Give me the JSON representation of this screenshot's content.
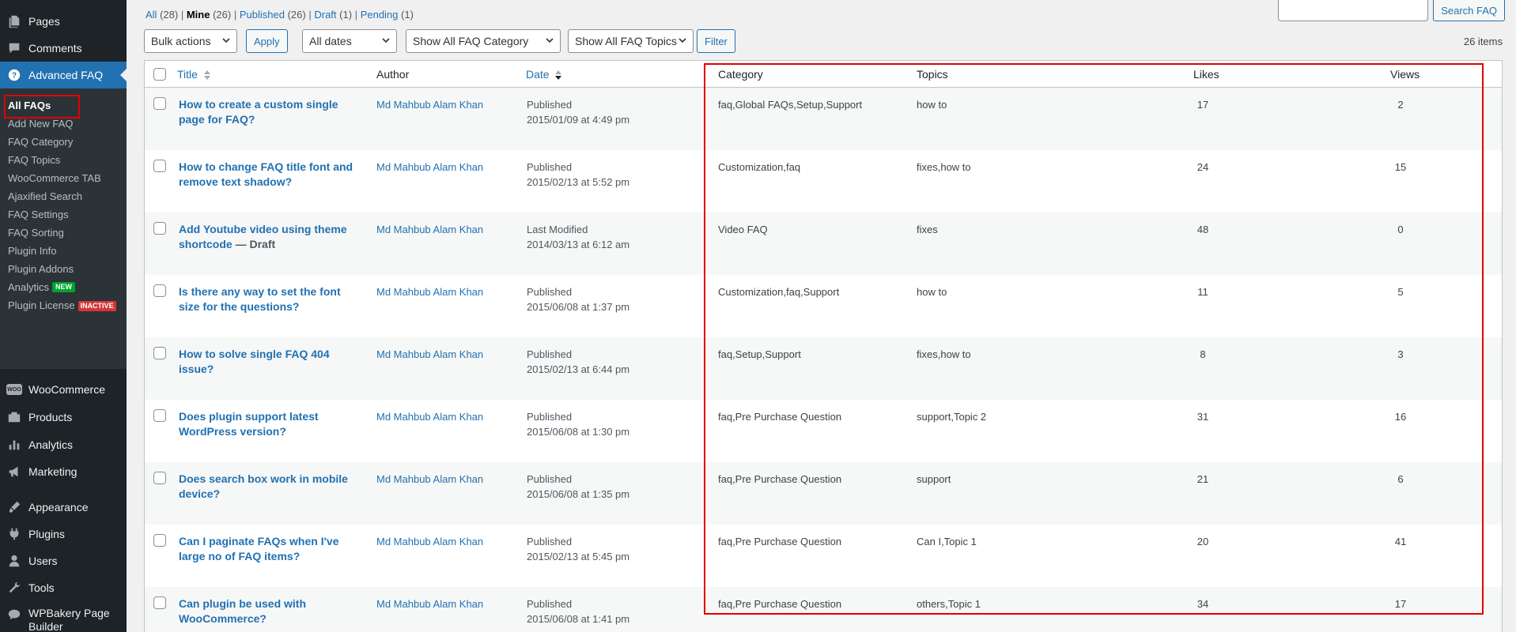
{
  "sidebar": {
    "menu": [
      {
        "label": "Pages",
        "icon": "pages-icon"
      },
      {
        "label": "Comments",
        "icon": "comments-icon"
      },
      {
        "label": "Advanced FAQ",
        "icon": "help-icon"
      }
    ],
    "submenu": [
      {
        "label": "All FAQs"
      },
      {
        "label": "Add New FAQ"
      },
      {
        "label": "FAQ Category"
      },
      {
        "label": "FAQ Topics"
      },
      {
        "label": "WooCommerce TAB"
      },
      {
        "label": "Ajaxified Search"
      },
      {
        "label": "FAQ Settings"
      },
      {
        "label": "FAQ Sorting"
      },
      {
        "label": "Plugin Info"
      },
      {
        "label": "Plugin Addons"
      },
      {
        "label": "Analytics",
        "badge": "NEW"
      },
      {
        "label": "Plugin License",
        "badge": "INACTIVE"
      }
    ],
    "menu2": [
      {
        "label": "WooCommerce",
        "icon": "woo-icon",
        "logo_text": "WOO"
      },
      {
        "label": "Products",
        "icon": "products-icon"
      },
      {
        "label": "Analytics",
        "icon": "analytics-icon"
      },
      {
        "label": "Marketing",
        "icon": "marketing-icon"
      },
      {
        "label": "Appearance",
        "icon": "appearance-icon"
      },
      {
        "label": "Plugins",
        "icon": "plugins-icon"
      },
      {
        "label": "Users",
        "icon": "users-icon"
      },
      {
        "label": "Tools",
        "icon": "tools-icon"
      },
      {
        "label": "WPBakery Page Builder",
        "icon": "wpbakery-icon"
      }
    ]
  },
  "views": [
    {
      "label": "All",
      "count": "(28)"
    },
    {
      "label": "Mine",
      "count": "(26)",
      "current": true
    },
    {
      "label": "Published",
      "count": "(26)"
    },
    {
      "label": "Draft",
      "count": "(1)"
    },
    {
      "label": "Pending",
      "count": "(1)"
    }
  ],
  "view_separator": "|",
  "search": {
    "button": "Search FAQ",
    "value": ""
  },
  "filters": {
    "bulk_actions": "Bulk actions",
    "apply": "Apply",
    "dates": "All dates",
    "category": "Show All FAQ Category",
    "topics": "Show All FAQ Topics",
    "filter": "Filter"
  },
  "items_count": "26 items",
  "columns": {
    "title": "Title",
    "author": "Author",
    "date": "Date",
    "category": "Category",
    "topics": "Topics",
    "likes": "Likes",
    "views": "Views"
  },
  "rows": [
    {
      "title": "How to create a custom single page for FAQ?",
      "state": "",
      "author": "Md Mahbub Alam Khan",
      "status": "Published",
      "date": "2015/01/09 at 4:49 pm",
      "category": "faq,Global FAQs,Setup,Support",
      "topics": "how to",
      "likes": "17",
      "views": "2"
    },
    {
      "title": "How to change FAQ title font and remove text shadow?",
      "state": "",
      "author": "Md Mahbub Alam Khan",
      "status": "Published",
      "date": "2015/02/13 at 5:52 pm",
      "category": "Customization,faq",
      "topics": "fixes,how to",
      "likes": "24",
      "views": "15"
    },
    {
      "title": "Add Youtube video using theme shortcode",
      "state": "— Draft",
      "author": "Md Mahbub Alam Khan",
      "status": "Last Modified",
      "date": "2014/03/13 at 6:12 am",
      "category": "Video FAQ",
      "topics": "fixes",
      "likes": "48",
      "views": "0"
    },
    {
      "title": "Is there any way to set the font size for the questions?",
      "state": "",
      "author": "Md Mahbub Alam Khan",
      "status": "Published",
      "date": "2015/06/08 at 1:37 pm",
      "category": "Customization,faq,Support",
      "topics": "how to",
      "likes": "11",
      "views": "5"
    },
    {
      "title": "How to solve single FAQ 404 issue?",
      "state": "",
      "author": "Md Mahbub Alam Khan",
      "status": "Published",
      "date": "2015/02/13 at 6:44 pm",
      "category": "faq,Setup,Support",
      "topics": "fixes,how to",
      "likes": "8",
      "views": "3"
    },
    {
      "title": "Does plugin support latest WordPress version?",
      "state": "",
      "author": "Md Mahbub Alam Khan",
      "status": "Published",
      "date": "2015/06/08 at 1:30 pm",
      "category": "faq,Pre Purchase Question",
      "topics": "support,Topic 2",
      "likes": "31",
      "views": "16"
    },
    {
      "title": "Does search box work in mobile device?",
      "state": "",
      "author": "Md Mahbub Alam Khan",
      "status": "Published",
      "date": "2015/06/08 at 1:35 pm",
      "category": "faq,Pre Purchase Question",
      "topics": "support",
      "likes": "21",
      "views": "6"
    },
    {
      "title": "Can I paginate FAQs when I've large no of FAQ items?",
      "state": "",
      "author": "Md Mahbub Alam Khan",
      "status": "Published",
      "date": "2015/02/13 at 5:45 pm",
      "category": "faq,Pre Purchase Question",
      "topics": "Can I,Topic 1",
      "likes": "20",
      "views": "41"
    },
    {
      "title": "Can plugin be used with WooCommerce?",
      "state": "",
      "author": "Md Mahbub Alam Khan",
      "status": "Published",
      "date": "2015/06/08 at 1:41 pm",
      "category": "faq,Pre Purchase Question",
      "topics": "others,Topic 1",
      "likes": "34",
      "views": "17"
    }
  ],
  "colors": {
    "sidebar_bg": "#1d2327",
    "submenu_bg": "#2c3338",
    "accent": "#2271b1",
    "highlight": "#e10000"
  }
}
